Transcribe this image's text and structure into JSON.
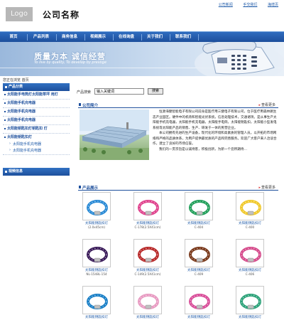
{
  "header": {
    "logo_text": "Logo",
    "company_name": "公司名称",
    "top_links": [
      "公司新闻",
      "手交我们",
      "海增页"
    ]
  },
  "nav": {
    "items": [
      "首页",
      "产品列表",
      "商务信息",
      "视频展示",
      "在线询盘",
      "关于我们",
      "联系我们"
    ]
  },
  "banner": {
    "slogan": "质量为本  诚信经营",
    "slogan_en": "To live by quality, To develop by prestige"
  },
  "sidebar": {
    "location": "您正在浏览 首页",
    "categories_title": "产品分类",
    "categories": [
      {
        "label": "太阳能手电筒灯太阳能草坪 用灯",
        "sub": []
      },
      {
        "label": "太阳能手机充电器",
        "sub": []
      },
      {
        "label": "太阳能手机充电器",
        "sub": []
      },
      {
        "label": "太阳能手机充电器",
        "sub": []
      },
      {
        "label": "太阳能钥匙扣灯钥匙扣 灯",
        "sub": []
      },
      {
        "label": "太阳能钥匙扣灯",
        "sub": [
          "太阳能手机充电器",
          "太阳能手机充电器"
        ]
      }
    ],
    "video_title": "视频信息"
  },
  "search": {
    "label": "产品搜索",
    "value": "输入关键词",
    "button": "搜索"
  },
  "about": {
    "title": "公司简介",
    "more": "查看更多",
    "paragraphs": [
      "恒源海健智能电子有限公司前身是医疗用三健电子有限公司，位于医疗用森林路生态产业园区。硬件中的机场和智能光伏系统，信息处理技术，交通诸项。是从事生产太阳能手机充电器，太阳能手机充电器，太阳能手电筒，太阳能钥匙扣，太阳能小型发电系统等太阳能产品的销售、生产、研发于一体的民营企业。",
      "本公司拥有先进的生产设备，现代化的环境和高素质的管理人员。以开拓的市场网络和严格的品质体系，为用户提供最优质的产品和完善服务。欢迎广大客户来人洽谈合作，建立了良好的市场信誉。",
      "我们的一贯宗旨是以诚待客，积极创新，为新一个您所期待…"
    ]
  },
  "products": {
    "title": "产品展示",
    "more": "查看更多",
    "items": [
      {
        "name": "太阳能钥匙扣灯",
        "code": "(2.0x45cm)",
        "color": "#2b8bd6"
      },
      {
        "name": "太阳能钥匙扣灯",
        "code": "C-178(2.5X41cm)",
        "color": "#e0448e"
      },
      {
        "name": "太阳能钥匙扣灯",
        "code": "C-404",
        "color": "#23a05b"
      },
      {
        "name": "太阳能钥匙扣灯",
        "code": "C-400",
        "color": "#f0c92c"
      },
      {
        "name": "太阳能钥匙扣灯",
        "code": "NL-1548L-154",
        "color": "#3b1c5a"
      },
      {
        "name": "太阳能钥匙扣灯",
        "code": "C-149(2.5X41cm)",
        "color": "#b82a2a"
      },
      {
        "name": "太阳能钥匙扣灯",
        "code": "C-409",
        "color": "#7a3a1c"
      },
      {
        "name": "太阳能钥匙扣灯",
        "code": "C-406",
        "color": "#d64c8c"
      },
      {
        "name": "太阳能钥匙扣灯",
        "code": "",
        "color": "#1b80c7"
      },
      {
        "name": "太阳能钥匙扣灯",
        "code": "",
        "color": "#e89bc2"
      },
      {
        "name": "太阳能钥匙扣灯",
        "code": "",
        "color": "#d94f9a"
      },
      {
        "name": "太阳能钥匙扣灯",
        "code": "",
        "color": "#2ea37a"
      }
    ]
  },
  "colors": {
    "nav_blue": "#1d4f9c",
    "link_blue": "#1e5aa8",
    "banner_blue": "#9ab8dc"
  }
}
